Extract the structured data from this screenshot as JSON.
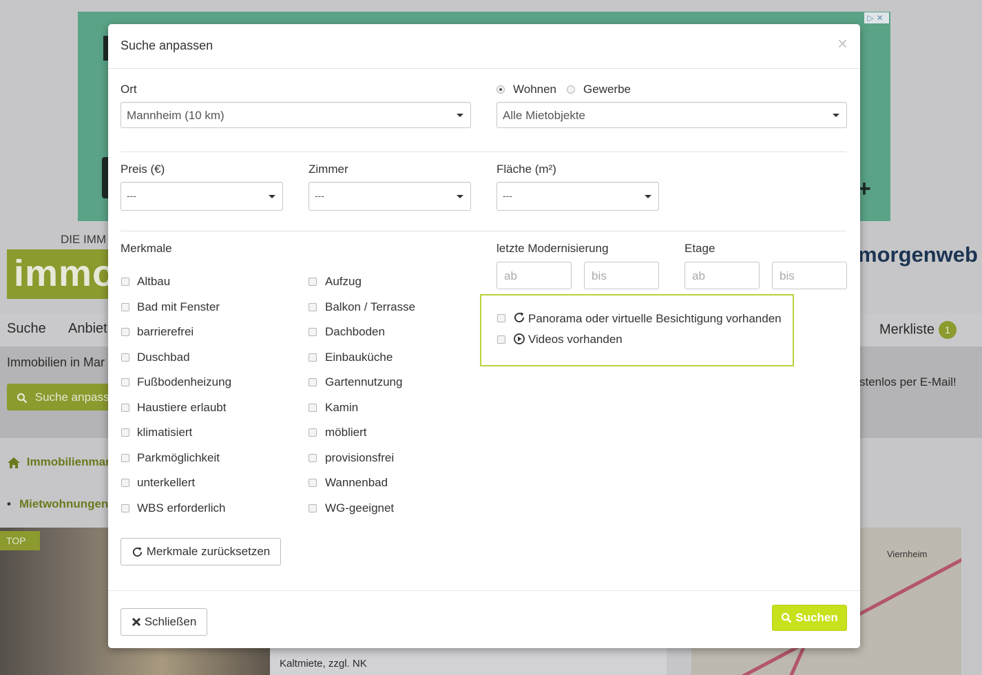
{
  "background": {
    "tagline": "DIE IMM",
    "logo_text": "immo",
    "brand": "morgenweb",
    "ad_controls": "▷✕",
    "ad_plus": "+",
    "nav": {
      "search": "Suche",
      "offer": "Anbiet",
      "watchlist": "Merkliste",
      "watchlist_count": "1"
    },
    "subheader_title": "Immobilien in Mar",
    "subheader_right": "stenlos per E-Mail!",
    "search_button": "Suche anpass",
    "breadcrumb": "Immobilienmar",
    "list_link": "Mietwohnungen",
    "top_tag": "TOP",
    "listing_price_line": "Kaltmiete, zzgl. NK",
    "map_label": "Viernheim"
  },
  "modal": {
    "title": "Suche anpassen",
    "close_symbol": "×",
    "location": {
      "label": "Ort",
      "value": "Mannheim (10 km)"
    },
    "property_type": {
      "options": [
        {
          "label": "Wohnen",
          "selected": true
        },
        {
          "label": "Gewerbe",
          "selected": false
        }
      ],
      "select_value": "Alle Mietobjekte"
    },
    "price": {
      "label": "Preis (€)",
      "value": "---"
    },
    "rooms": {
      "label": "Zimmer",
      "value": "---"
    },
    "area": {
      "label": "Fläche (m²)",
      "value": "---"
    },
    "features": {
      "label": "Merkmale",
      "col1": [
        "Altbau",
        "Bad mit Fenster",
        "barrierefrei",
        "Duschbad",
        "Fußbodenheizung",
        "Haustiere erlaubt",
        "klimatisiert",
        "Parkmöglichkeit",
        "unterkellert",
        "WBS erforderlich"
      ],
      "col2": [
        "Aufzug",
        "Balkon / Terrasse",
        "Dachboden",
        "Einbauküche",
        "Gartennutzung",
        "Kamin",
        "möbliert",
        "provisionsfrei",
        "Wannenbad",
        "WG-geeignet"
      ],
      "reset_label": "Merkmale zurücksetzen"
    },
    "modernization": {
      "label": "letzte Modernisierung",
      "from_placeholder": "ab",
      "to_placeholder": "bis"
    },
    "floor": {
      "label": "Etage",
      "from_placeholder": "ab",
      "to_placeholder": "bis"
    },
    "media": {
      "panorama": "Panorama oder virtuelle Besichtigung vorhanden",
      "videos": "Videos vorhanden"
    },
    "close_label": "Schließen",
    "search_label": "Suchen",
    "colors": {
      "accent": "#c7e11c",
      "highlight_border": "#b9d23a"
    }
  }
}
